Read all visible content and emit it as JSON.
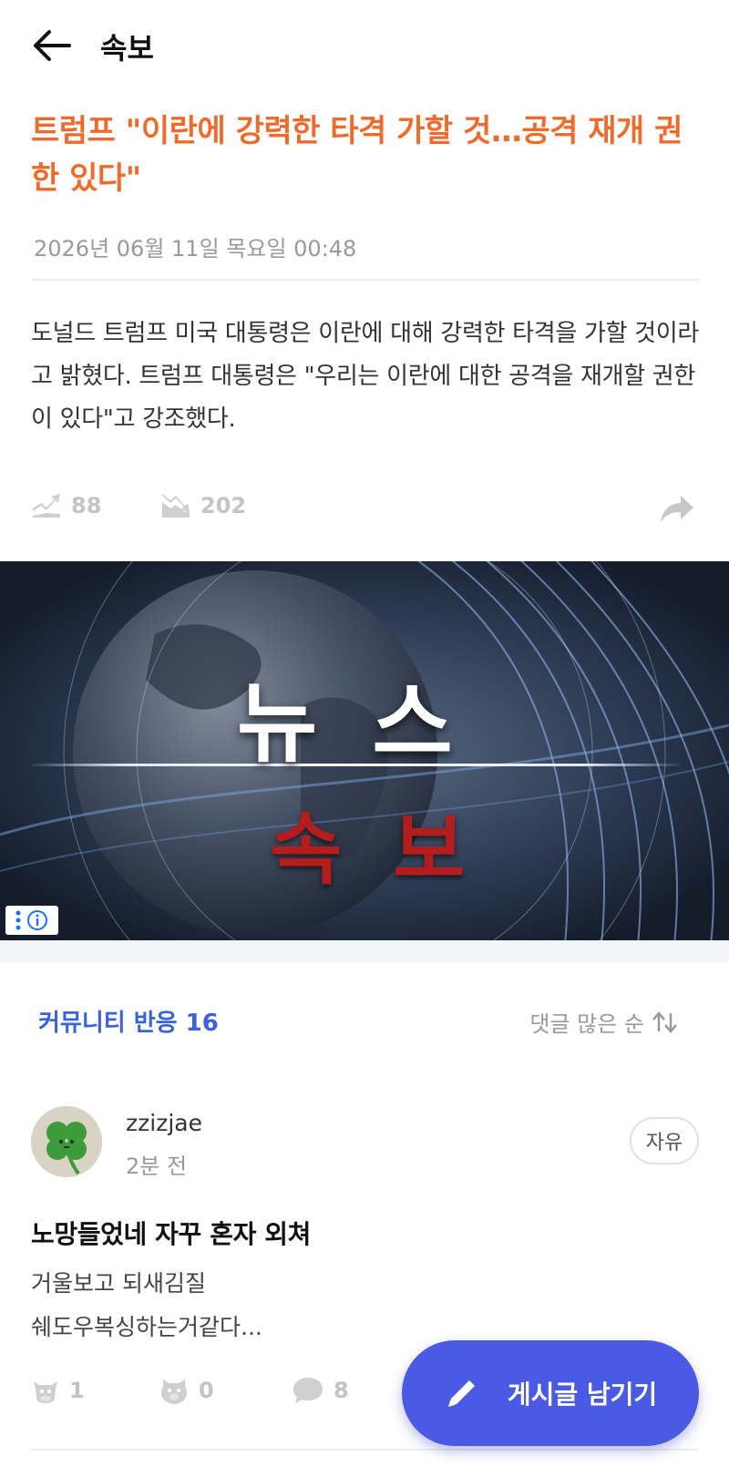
{
  "header": {
    "title": "속보"
  },
  "article": {
    "title": "트럼프 \"이란에 강력한 타격 가할 것…공격 재개 권한 있다\"",
    "date": "2026년 06월 11일 목요일 00:48",
    "body": "도널드 트럼프 미국 대통령은 이란에 대해 강력한 타격을 가할 것이라고 밝혔다. 트럼프 대통령은 \"우리는 이란에 대한 공격을 재개할 권한이 있다\"고 강조했다.",
    "stats": {
      "up_count": "88",
      "down_count": "202"
    }
  },
  "banner": {
    "news_text": "뉴스",
    "breaking_text": "속보"
  },
  "community": {
    "header": "커뮤니티 반응 16",
    "sort_label": "댓글 많은 순",
    "post": {
      "username": "zzizjae",
      "time": "2분 전",
      "tag": "자유",
      "title": "노망들었네 자꾸 혼자 외쳐",
      "body_line1": "거울보고 되새김질",
      "body_line2": "쉐도우복싱하는거같다...",
      "reactions": {
        "like": "1",
        "dislike": "0",
        "comments": "8"
      }
    }
  },
  "fab": {
    "label": "게시글 남기기"
  },
  "colors": {
    "accent_orange": "#ef6b2c",
    "accent_blue": "#3a63d9",
    "fab_blue": "#4b5ae4",
    "breaking_red": "#b31d1d"
  },
  "icons": [
    "back-arrow-icon",
    "trend-up-icon",
    "trend-down-icon",
    "share-arrow-icon",
    "ad-menu-icon",
    "ad-info-icon",
    "sort-arrows-icon",
    "clover-avatar",
    "cow-icon",
    "pig-icon",
    "comment-bubble-icon",
    "pencil-icon"
  ]
}
